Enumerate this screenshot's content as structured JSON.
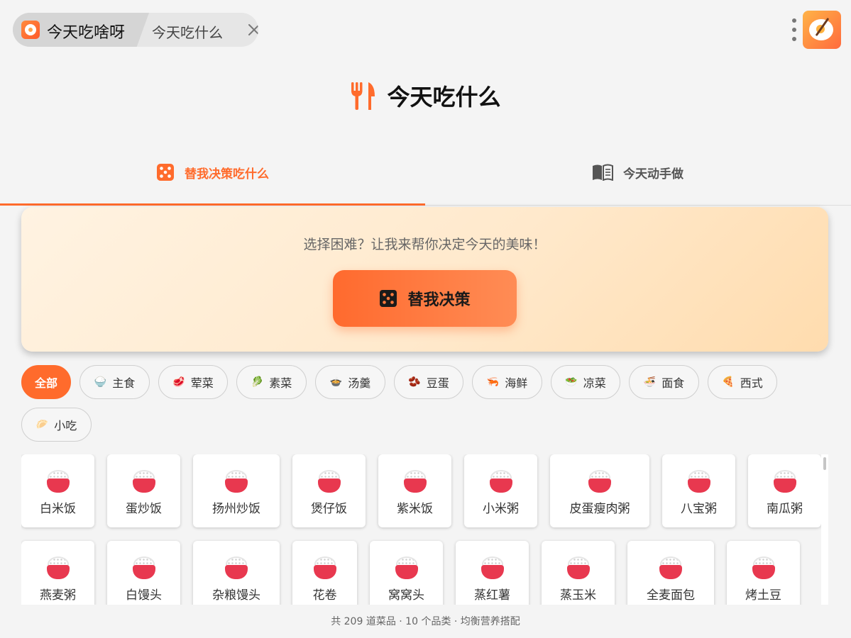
{
  "window": {
    "app_title": "今天吃啥呀",
    "page_title": "今天吃什么",
    "icons": {
      "app": "bowl-logo-icon",
      "close": "close-icon",
      "menu": "kebab-menu-icon",
      "avatar": "food-avatar-icon"
    }
  },
  "header": {
    "title": "今天吃什么",
    "icon": "fork-knife-icon",
    "accent": "#ff6b2c"
  },
  "tabs": [
    {
      "label": "替我决策吃什么",
      "icon": "dice-icon",
      "active": true
    },
    {
      "label": "今天动手做",
      "icon": "recipe-book-icon",
      "active": false
    }
  ],
  "decide": {
    "prompt": "选择困难？让我来帮你决定今天的美味！",
    "button_label": "替我决策",
    "button_icon": "dice-icon"
  },
  "categories": [
    {
      "label": "全部",
      "emoji": "",
      "active": true
    },
    {
      "label": "主食",
      "emoji": "🍚",
      "active": false
    },
    {
      "label": "荤菜",
      "emoji": "🥩",
      "active": false
    },
    {
      "label": "素菜",
      "emoji": "🥬",
      "active": false
    },
    {
      "label": "汤羹",
      "emoji": "🍲",
      "active": false
    },
    {
      "label": "豆蛋",
      "emoji": "🫘",
      "active": false
    },
    {
      "label": "海鲜",
      "emoji": "🦐",
      "active": false
    },
    {
      "label": "凉菜",
      "emoji": "🥗",
      "active": false
    },
    {
      "label": "面食",
      "emoji": "🍜",
      "active": false
    },
    {
      "label": "西式",
      "emoji": "🍕",
      "active": false
    },
    {
      "label": "小吃",
      "emoji": "🥟",
      "active": false
    }
  ],
  "dishes": [
    [
      "白米饭",
      "蛋炒饭",
      "扬州炒饭",
      "煲仔饭",
      "紫米饭",
      "小米粥",
      "皮蛋瘦肉粥",
      "八宝粥",
      "南瓜粥"
    ],
    [
      "燕麦粥",
      "白馒头",
      "杂粮馒头",
      "花卷",
      "窝窝头",
      "蒸红薯",
      "蒸玉米",
      "全麦面包",
      "烤土豆"
    ]
  ],
  "footer": {
    "summary": "共 209 道菜品 · 10 个品类 · 均衡营养搭配"
  }
}
